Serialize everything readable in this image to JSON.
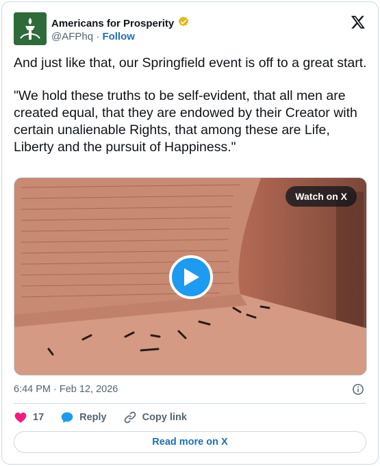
{
  "account": {
    "name": "Americans for Prosperity",
    "handle": "@AFPhq",
    "separator": "·",
    "follow_label": "Follow",
    "verified_badge_color": "#e2b719"
  },
  "post": {
    "paragraphs": [
      "And just like that, our Springfield event is off to a great start.",
      "\"We hold these truths to be self-evident, that all men are created equal, that they are endowed by their Creator with certain unalienable Rights, that among these are Life, Liberty and the pursuit of Happiness.\""
    ]
  },
  "media": {
    "watch_label": "Watch on X",
    "play_color": "#1d9bf0"
  },
  "meta": {
    "timestamp": "6:44 PM · Feb 12, 2026"
  },
  "actions": {
    "like_count": "17",
    "reply_label": "Reply",
    "copy_label": "Copy link",
    "like_color": "#f91880",
    "reply_color": "#1d9bf0"
  },
  "footer": {
    "read_more_label": "Read more on X"
  },
  "icons": [
    "torch-logo-avatar",
    "verified-badge-icon",
    "x-logo-icon",
    "play-icon",
    "info-icon",
    "heart-icon",
    "reply-bubble-icon",
    "link-icon"
  ]
}
